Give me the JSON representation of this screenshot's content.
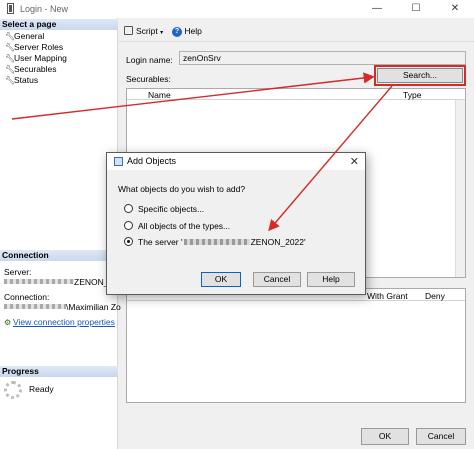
{
  "window": {
    "title": "Login - New",
    "minimize": "—",
    "maximize": "☐",
    "close": "✕"
  },
  "sidebar": {
    "select_page_header": "Select a page",
    "items": [
      {
        "label": "General"
      },
      {
        "label": "Server Roles"
      },
      {
        "label": "User Mapping"
      },
      {
        "label": "Securables"
      },
      {
        "label": "Status"
      }
    ],
    "connection_header": "Connection",
    "server_label": "Server:",
    "server_value_tail": "ZENON_2",
    "connection_label": "Connection:",
    "connection_value_tail": "\\Maximilian Zo",
    "view_properties_link": "View connection properties",
    "progress_header": "Progress",
    "progress_status": "Ready"
  },
  "toolbar": {
    "script_label": "Script",
    "help_label": "Help"
  },
  "form": {
    "login_name_label": "Login name:",
    "login_name_value": "zenOnSrv",
    "securables_label": "Securables:",
    "search_button": "Search..."
  },
  "securables_grid": {
    "columns": [
      "Name",
      "Type"
    ]
  },
  "permissions_grid": {
    "columns": [
      "With Grant",
      "Deny"
    ]
  },
  "footer": {
    "ok": "OK",
    "cancel": "Cancel"
  },
  "dialog": {
    "title": "Add Objects",
    "close": "✕",
    "question": "What objects do you wish to add?",
    "options": [
      {
        "label": "Specific objects...",
        "selected": false
      },
      {
        "label": "All objects of the types...",
        "selected": false
      },
      {
        "label_prefix": "The server '",
        "label_suffix": "ZENON_2022'",
        "selected": true
      }
    ],
    "ok": "OK",
    "cancel": "Cancel",
    "help": "Help"
  },
  "colors": {
    "annotation_red": "#d32a2a",
    "link_blue": "#1a55b8",
    "section_header": "#c8d8ee"
  }
}
